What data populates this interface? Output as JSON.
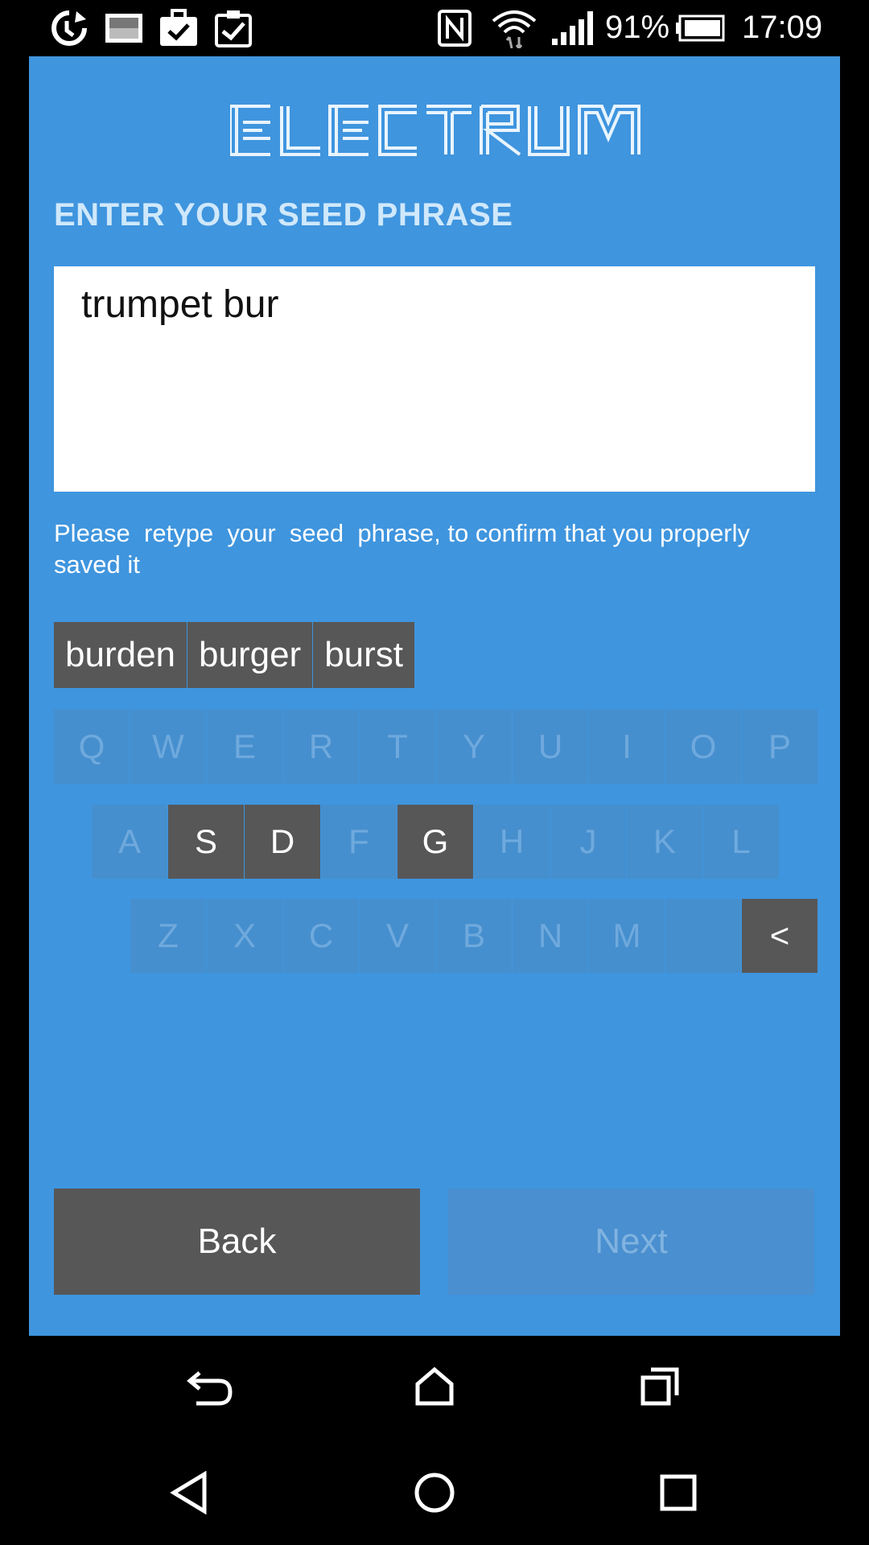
{
  "status_bar": {
    "battery": "91%",
    "time": "17:09",
    "icons": [
      "sync-icon",
      "image-icon",
      "briefcase-check-icon",
      "clipboard-check-icon",
      "nfc-icon",
      "wifi-icon",
      "signal-icon",
      "battery-icon"
    ]
  },
  "app": {
    "logo_text": "ELECTRUM",
    "heading": "ENTER YOUR SEED PHRASE",
    "seed_value": "trumpet bur",
    "hint": "Please  retype  your  seed  phrase, to confirm that you properly saved it",
    "suggestions": [
      "burden",
      "burger",
      "burst"
    ],
    "keyboard": {
      "row1": [
        "Q",
        "W",
        "E",
        "R",
        "T",
        "Y",
        "U",
        "I",
        "O",
        "P"
      ],
      "row2": [
        "A",
        "S",
        "D",
        "F",
        "G",
        "H",
        "J",
        "K",
        "L"
      ],
      "row3": [
        "Z",
        "X",
        "C",
        "V",
        "B",
        "N",
        "M"
      ],
      "enabled_keys": [
        "S",
        "D",
        "G"
      ],
      "backspace_label": "<"
    },
    "back_label": "Back",
    "next_label": "Next"
  },
  "colors": {
    "panel": "#3f95de",
    "key_disabled": "#468fce",
    "key_enabled": "#575757",
    "heading": "#cfe8fb"
  },
  "nav": {
    "top_icons": [
      "back-arrow-icon",
      "home-icon",
      "recent-apps-icon"
    ],
    "bottom_icons": [
      "nav-back-triangle-icon",
      "nav-home-circle-icon",
      "nav-overview-square-icon"
    ]
  }
}
